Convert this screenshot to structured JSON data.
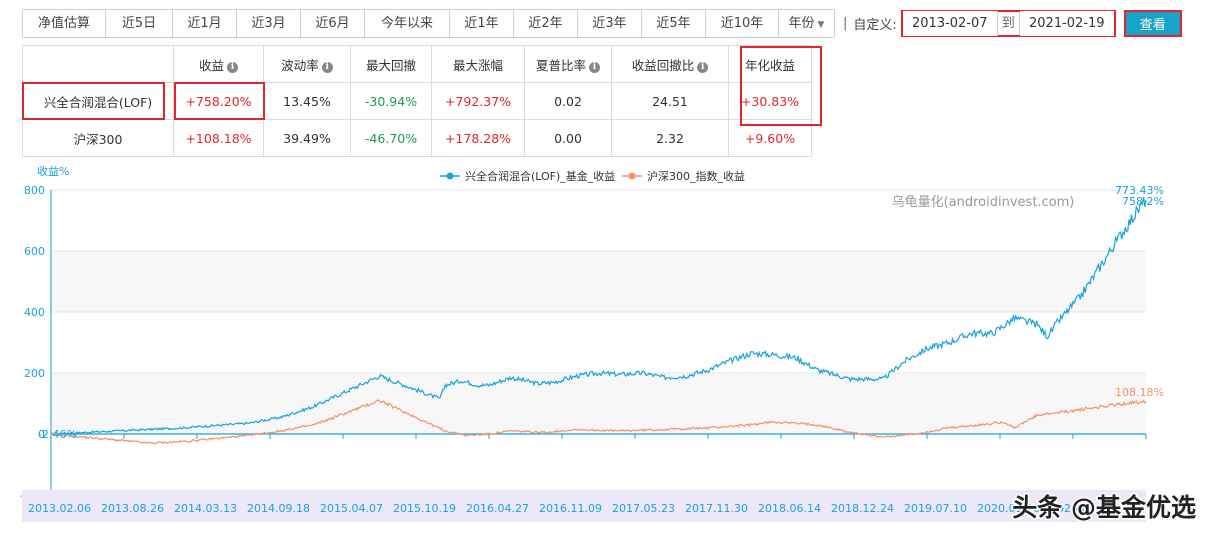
{
  "toolbar": {
    "periods": [
      "净值估算",
      "近5日",
      "近1月",
      "近3月",
      "近6月",
      "今年以来",
      "近1年",
      "近2年",
      "近3年",
      "近5年",
      "近10年",
      "年份"
    ],
    "separator": "|",
    "custom_label": "自定义:",
    "start_date": "2013-02-07",
    "to_label": "到",
    "end_date": "2021-02-19",
    "query_label": "查看"
  },
  "table": {
    "headers": [
      "收益",
      "波动率",
      "最大回撤",
      "最大涨幅",
      "夏普比率",
      "收益回撤比",
      "年化收益"
    ],
    "rows": [
      {
        "name": "兴全合润混合(LOF)",
        "values": [
          "+758.20%",
          "13.45%",
          "-30.94%",
          "+792.37%",
          "0.02",
          "24.51",
          "+30.83%"
        ]
      },
      {
        "name": "沪深300",
        "values": [
          "+108.18%",
          "39.49%",
          "-46.70%",
          "+178.28%",
          "0.00",
          "2.32",
          "+9.60%"
        ]
      }
    ]
  },
  "chart_data": {
    "type": "line",
    "ylabel": "收益%",
    "ylim": [
      -200,
      800
    ],
    "yticks": [
      -200,
      0,
      200,
      400,
      600,
      800
    ],
    "x_ticks": [
      "2013.02.06",
      "2013.08.26",
      "2014.03.13",
      "2014.09.18",
      "2015.04.07",
      "2015.10.19",
      "2016.04.27",
      "2016.11.09",
      "2017.05.23",
      "2017.11.30",
      "2018.06.14",
      "2018.12.24",
      "2019.07.10",
      "2020.01.20",
      "2020.08.04"
    ],
    "watermark": "乌龟量化(androidinvest.com)",
    "series": [
      {
        "name": "兴全合润混合(LOF)_基金_收益",
        "color": "#1aa3d8",
        "start_label": "-2.46%",
        "end_label": "773.43%",
        "end_label2": "758.2%",
        "x": [
          0,
          0.03,
          0.06,
          0.09,
          0.12,
          0.15,
          0.18,
          0.21,
          0.24,
          0.27,
          0.3,
          0.33,
          0.355,
          0.36,
          0.375,
          0.39,
          0.4,
          0.42,
          0.445,
          0.46,
          0.48,
          0.5,
          0.52,
          0.54,
          0.56,
          0.58,
          0.6,
          0.62,
          0.64,
          0.66,
          0.68,
          0.7,
          0.73,
          0.76,
          0.78,
          0.8,
          0.82,
          0.84,
          0.86,
          0.88,
          0.9,
          0.91,
          0.92,
          0.94,
          0.96,
          0.98,
          1.0
        ],
        "values": [
          0,
          5,
          10,
          15,
          20,
          28,
          35,
          55,
          90,
          140,
          190,
          150,
          115,
          160,
          175,
          160,
          160,
          185,
          165,
          170,
          190,
          200,
          195,
          200,
          185,
          190,
          210,
          240,
          265,
          260,
          250,
          210,
          180,
          180,
          240,
          280,
          300,
          330,
          330,
          380,
          360,
          320,
          370,
          450,
          560,
          670,
          770
        ]
      },
      {
        "name": "沪深300_指数_收益",
        "color": "#f0946a",
        "start_label": "",
        "end_label": "108.18%",
        "x": [
          0,
          0.03,
          0.06,
          0.09,
          0.12,
          0.15,
          0.18,
          0.21,
          0.24,
          0.27,
          0.3,
          0.33,
          0.36,
          0.38,
          0.4,
          0.42,
          0.45,
          0.48,
          0.52,
          0.56,
          0.6,
          0.64,
          0.66,
          0.68,
          0.7,
          0.73,
          0.76,
          0.79,
          0.82,
          0.85,
          0.87,
          0.88,
          0.9,
          0.94,
          0.97,
          1.0
        ],
        "values": [
          0,
          -10,
          -20,
          -30,
          -25,
          -15,
          -5,
          10,
          30,
          70,
          110,
          60,
          10,
          -5,
          0,
          10,
          5,
          15,
          10,
          15,
          20,
          30,
          40,
          35,
          30,
          5,
          -10,
          0,
          20,
          30,
          40,
          20,
          60,
          80,
          95,
          108
        ]
      }
    ]
  }
}
